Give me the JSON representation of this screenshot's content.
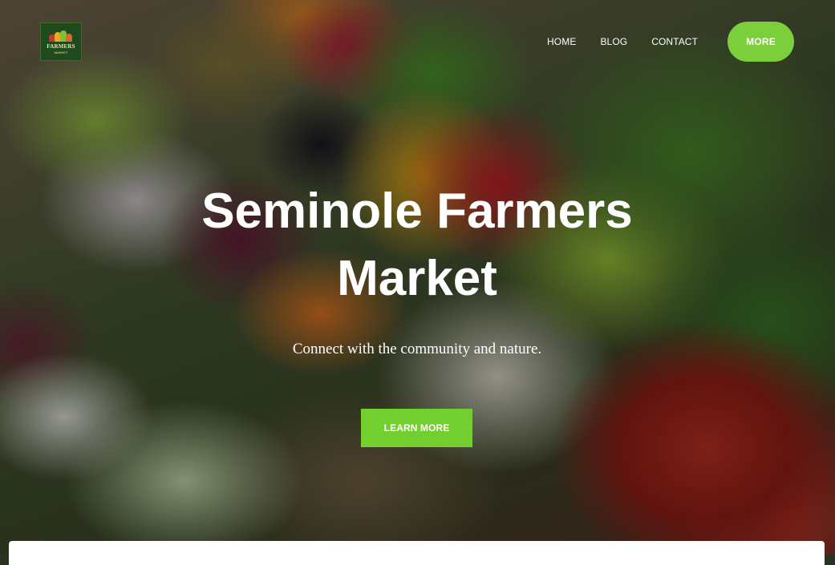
{
  "site": {
    "logo": {
      "text": "FARMERS",
      "sub": "MARKET",
      "icon": "farm-basket-icon"
    },
    "nav": {
      "items": [
        {
          "label": "HOME"
        },
        {
          "label": "BLOG"
        },
        {
          "label": "CONTACT"
        }
      ],
      "more_label": "MORE"
    }
  },
  "hero": {
    "title": "Seminole Farmers Market",
    "tagline": "Connect with the community and nature.",
    "cta_label": "LEARN MORE",
    "background": "produce-market-photo"
  },
  "colors": {
    "accent": "#7ccf3a",
    "logo_bg": "#1f4a1e",
    "text": "#ffffff"
  }
}
